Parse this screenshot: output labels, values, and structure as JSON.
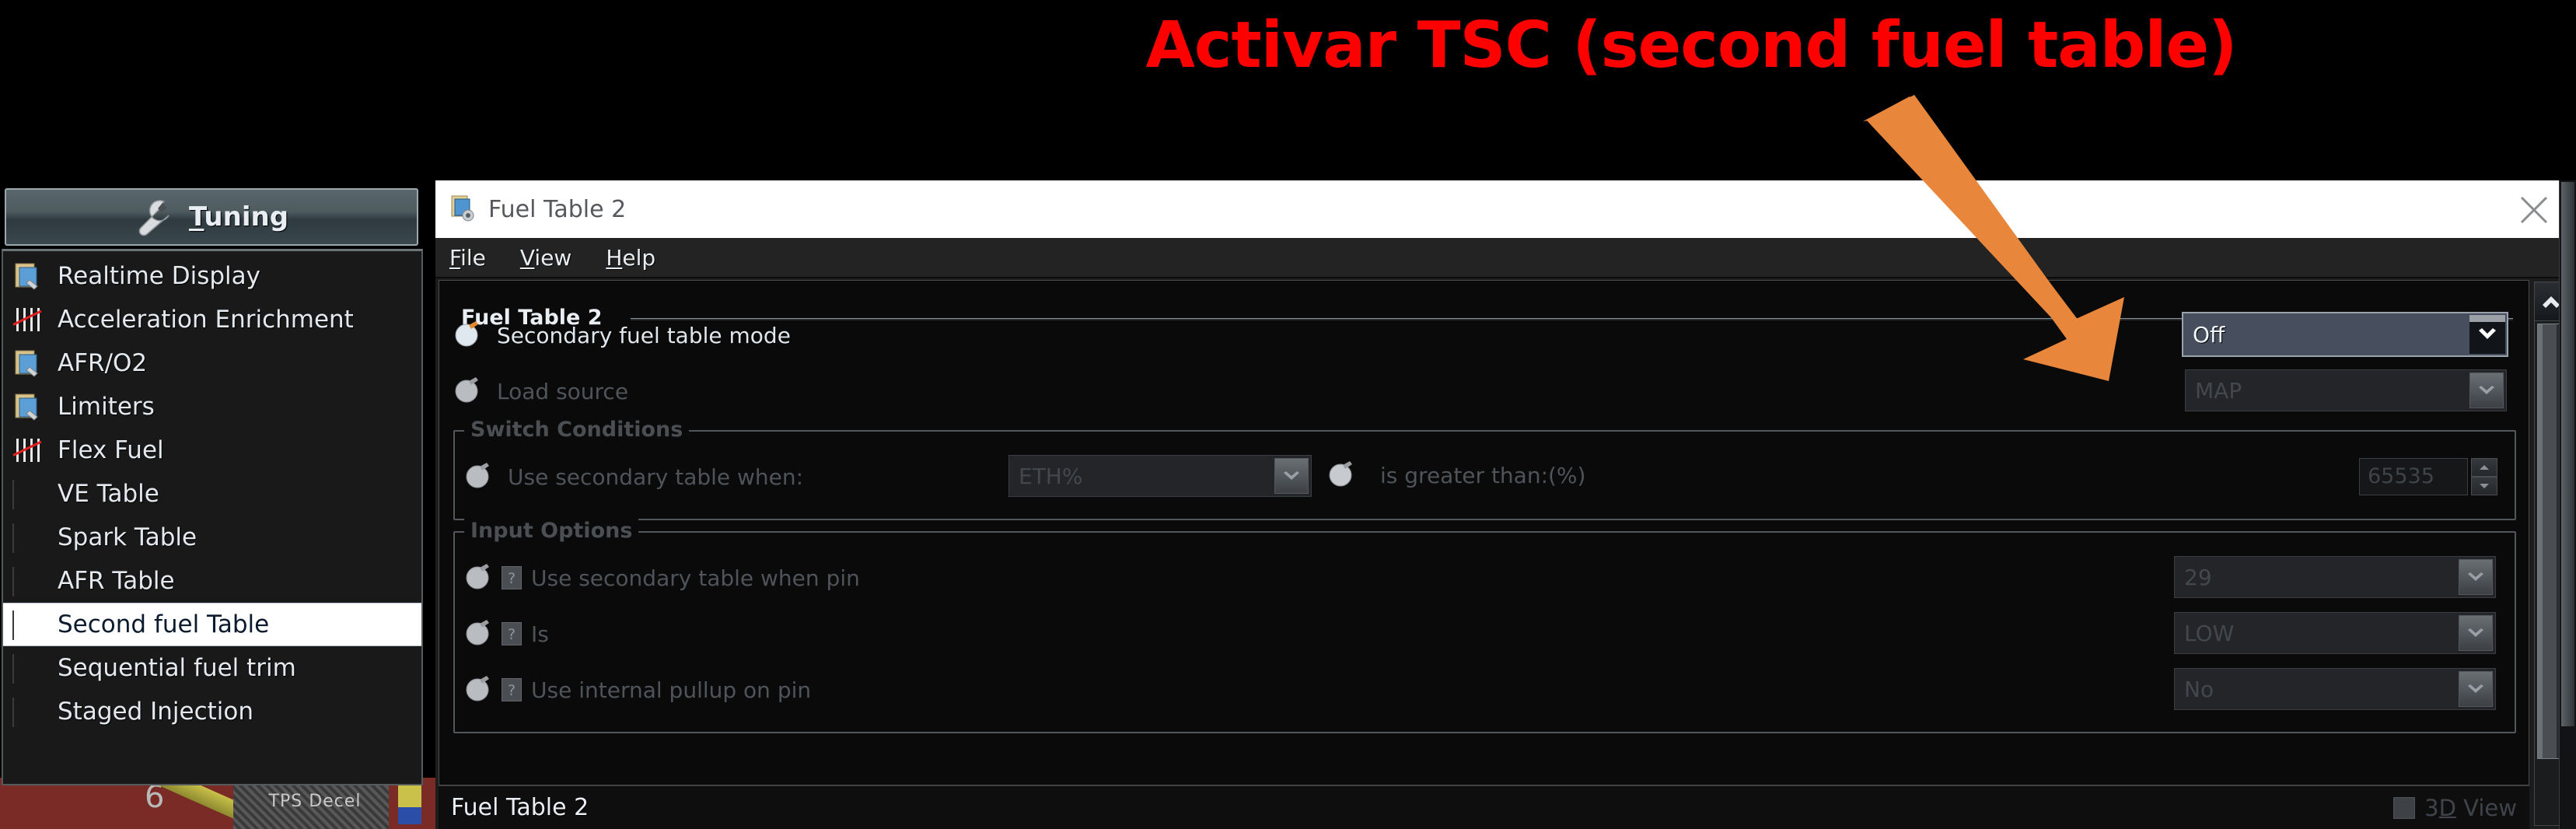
{
  "annotation": {
    "title": "Activar TSC (second fuel table)",
    "title_color": "#ff0000",
    "arrow_color": "#e8873c",
    "arrow_name": "orange-arrow-pointing-to-mode-dropdown"
  },
  "sidebar": {
    "tuning_button": {
      "label_prefix": "T",
      "label_rest": "uning",
      "icon": "wrench-icon"
    },
    "items": [
      {
        "label": "Realtime Display",
        "icon": "document-wrench-icon",
        "selected": false
      },
      {
        "label": "Acceleration Enrichment",
        "icon": "curve-bars-icon",
        "selected": false
      },
      {
        "label": "AFR/O2",
        "icon": "document-wrench-icon",
        "selected": false
      },
      {
        "label": "Limiters",
        "icon": "document-wrench-icon",
        "selected": false
      },
      {
        "label": "Flex Fuel",
        "icon": "curve-bars-icon",
        "selected": false
      },
      {
        "label": "VE Table",
        "icon": "color-table-icon",
        "selected": false
      },
      {
        "label": "Spark Table",
        "icon": "color-table-icon",
        "selected": false
      },
      {
        "label": "AFR Table",
        "icon": "color-table-icon",
        "selected": false
      },
      {
        "label": "Second fuel Table",
        "icon": "color-table-icon",
        "selected": true
      },
      {
        "label": "Sequential fuel trim",
        "icon": "color-table-icon",
        "selected": false
      },
      {
        "label": "Staged Injection",
        "icon": "color-table-icon",
        "selected": false
      }
    ]
  },
  "background_gauge": {
    "label": "TPS Decel",
    "value": "6"
  },
  "dialog": {
    "titlebar": {
      "title": "Fuel Table 2",
      "icon": "document-gear-icon",
      "close_icon": "close-icon"
    },
    "menubar": [
      {
        "mnemonic": "F",
        "rest": "ile"
      },
      {
        "mnemonic": "V",
        "rest": "iew"
      },
      {
        "mnemonic": "H",
        "rest": "elp"
      }
    ],
    "group_main": {
      "title": "Fuel Table 2",
      "rows": [
        {
          "label": "Secondary fuel table mode",
          "enabled": true,
          "bulb_icon": "lit-bulb-icon",
          "value": "Off",
          "dropdown_icon": "chevron-down-icon"
        },
        {
          "label": "Load source",
          "enabled": false,
          "bulb_icon": "dim-bulb-icon",
          "value": "MAP",
          "dropdown_icon": "chevron-down-icon"
        }
      ]
    },
    "group_switch": {
      "title": "Switch Conditions",
      "label": "Use secondary table when:",
      "bulb_icon": "dim-bulb-icon",
      "condition_value": "ETH%",
      "condition_dropdown_icon": "chevron-down-icon",
      "mid_bulb_icon": "dim-bulb-icon",
      "mid_label": "is greater than:(%)",
      "threshold_value": "65535",
      "spin_up_icon": "spinner-up-icon",
      "spin_down_icon": "spinner-down-icon"
    },
    "group_input": {
      "title": "Input Options",
      "rows": [
        {
          "label": "Use secondary table when pin",
          "bulb_icon": "dim-bulb-icon",
          "help_icon": "help-question-icon",
          "value": "29",
          "dropdown_icon": "chevron-down-icon"
        },
        {
          "label": "Is",
          "bulb_icon": "dim-bulb-icon",
          "help_icon": "help-question-icon",
          "value": "LOW",
          "dropdown_icon": "chevron-down-icon"
        },
        {
          "label": "Use internal pullup on pin",
          "bulb_icon": "dim-bulb-icon",
          "help_icon": "help-question-icon",
          "value": "No",
          "dropdown_icon": "chevron-down-icon"
        }
      ]
    },
    "statusbar": {
      "text": "Fuel Table 2",
      "view3d_mnemonic": "D",
      "view3d_prefix": "3",
      "view3d_rest": " View",
      "checkbox_name": "3d-view-checkbox"
    },
    "scrollbar": {
      "up_icon": "scroll-up-icon"
    }
  }
}
